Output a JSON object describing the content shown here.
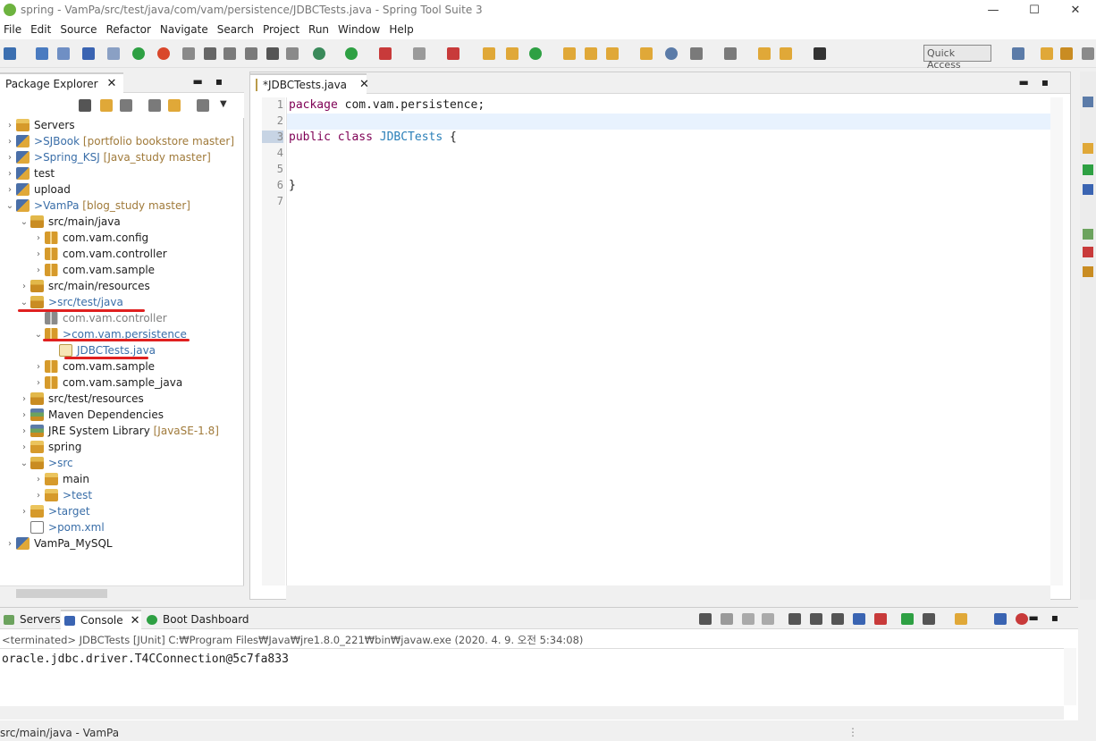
{
  "window": {
    "title": "spring - VamPa/src/test/java/com/vam/persistence/JDBCTests.java - Spring Tool Suite 3",
    "minimize": "—",
    "maximize": "☐",
    "close": "✕"
  },
  "menu": [
    "File",
    "Edit",
    "Source",
    "Refactor",
    "Navigate",
    "Search",
    "Project",
    "Run",
    "Window",
    "Help"
  ],
  "toolbar": {
    "quick_access": "Quick Access"
  },
  "package_explorer": {
    "tab_label": "Package Explorer",
    "close": "✕",
    "minmax": "▬▪",
    "tree": [
      {
        "label": "Servers",
        "deco": "",
        "icon": "folder",
        "level": 0
      },
      {
        "label": "SJBook",
        "deco": "[portfolio bookstore master]",
        "prefix": "> ",
        "icon": "proj",
        "level": 0
      },
      {
        "label": "Spring_KSJ",
        "deco": "[Java_study master]",
        "prefix": "> ",
        "icon": "proj",
        "level": 0
      },
      {
        "label": "test",
        "deco": "",
        "icon": "proj",
        "level": 0
      },
      {
        "label": "upload",
        "deco": "",
        "icon": "proj",
        "level": 0
      },
      {
        "label": "VamPa",
        "deco": "[blog_study master]",
        "prefix": "> ",
        "icon": "proj",
        "level": 0
      },
      {
        "label": "src/main/java",
        "deco": "",
        "icon": "srcf",
        "level": 1
      },
      {
        "label": "com.vam.config",
        "deco": "",
        "icon": "pkg",
        "level": 2
      },
      {
        "label": "com.vam.controller",
        "deco": "",
        "icon": "pkg",
        "level": 2
      },
      {
        "label": "com.vam.sample",
        "deco": "",
        "icon": "pkg",
        "level": 2
      },
      {
        "label": "src/main/resources",
        "deco": "",
        "icon": "srcf",
        "level": 1
      },
      {
        "label": "src/test/java",
        "deco": "",
        "prefix": "> ",
        "icon": "srcf",
        "level": 1
      },
      {
        "label": "com.vam.controller",
        "deco": "",
        "icon": "pkgw",
        "level": 2,
        "muted": true
      },
      {
        "label": "com.vam.persistence",
        "deco": "",
        "prefix": "> ",
        "icon": "pkg",
        "level": 2
      },
      {
        "label": "JDBCTests.java",
        "deco": "",
        "prefix": "> ",
        "icon": "java",
        "level": 3
      },
      {
        "label": "com.vam.sample",
        "deco": "",
        "icon": "pkg",
        "level": 2
      },
      {
        "label": "com.vam.sample_java",
        "deco": "",
        "icon": "pkg",
        "level": 2
      },
      {
        "label": "src/test/resources",
        "deco": "",
        "icon": "srcf",
        "level": 1
      },
      {
        "label": "Maven Dependencies",
        "deco": "",
        "icon": "lib",
        "level": 1
      },
      {
        "label": "JRE System Library",
        "deco": "[JavaSE-1.8]",
        "icon": "lib",
        "level": 1
      },
      {
        "label": "spring",
        "deco": "",
        "icon": "folder",
        "level": 1
      },
      {
        "label": "src",
        "deco": "",
        "prefix": "> ",
        "icon": "srcf",
        "level": 1
      },
      {
        "label": "main",
        "deco": "",
        "icon": "folder",
        "level": 2
      },
      {
        "label": "test",
        "deco": "",
        "prefix": "> ",
        "icon": "folder",
        "level": 2
      },
      {
        "label": "target",
        "deco": "",
        "prefix": "> ",
        "icon": "folder",
        "level": 1
      },
      {
        "label": "pom.xml",
        "deco": "",
        "prefix": "> ",
        "icon": "xml",
        "level": 1
      },
      {
        "label": "VamPa_MySQL",
        "deco": "",
        "icon": "proj",
        "level": 0
      }
    ]
  },
  "editor": {
    "tab_label": "*JDBCTests.java",
    "close": "✕",
    "minmax": "▬▪",
    "line_numbers": [
      "1",
      "2",
      "3",
      "4",
      "5",
      "6",
      "7"
    ],
    "lines": [
      {
        "kw": "package",
        "rest": " com.vam.persistence;",
        "ty": ""
      },
      {
        "kw": "",
        "rest": "",
        "ty": ""
      },
      {
        "kw": "public class",
        "rest": " {",
        "ty": " JDBCTests"
      },
      {
        "kw": "",
        "rest": "",
        "ty": ""
      },
      {
        "kw": "",
        "rest": "",
        "ty": ""
      },
      {
        "kw": "",
        "rest": "}",
        "ty": ""
      },
      {
        "kw": "",
        "rest": "",
        "ty": ""
      }
    ]
  },
  "bottom": {
    "tabs": [
      "Servers",
      "Console",
      "Boot Dashboard"
    ],
    "close": "✕",
    "minmax": "▬▪",
    "console_status": "<terminated> JDBCTests [JUnit] C:₩Program Files₩Java₩jre1.8.0_221₩bin₩javaw.exe (2020. 4. 9. 오전 5:34:08)",
    "console_output": "oracle.jdbc.driver.T4CConnection@5c7fa833"
  },
  "statusbar": {
    "text": "src/main/java - VamPa",
    "dots": "⋮"
  }
}
